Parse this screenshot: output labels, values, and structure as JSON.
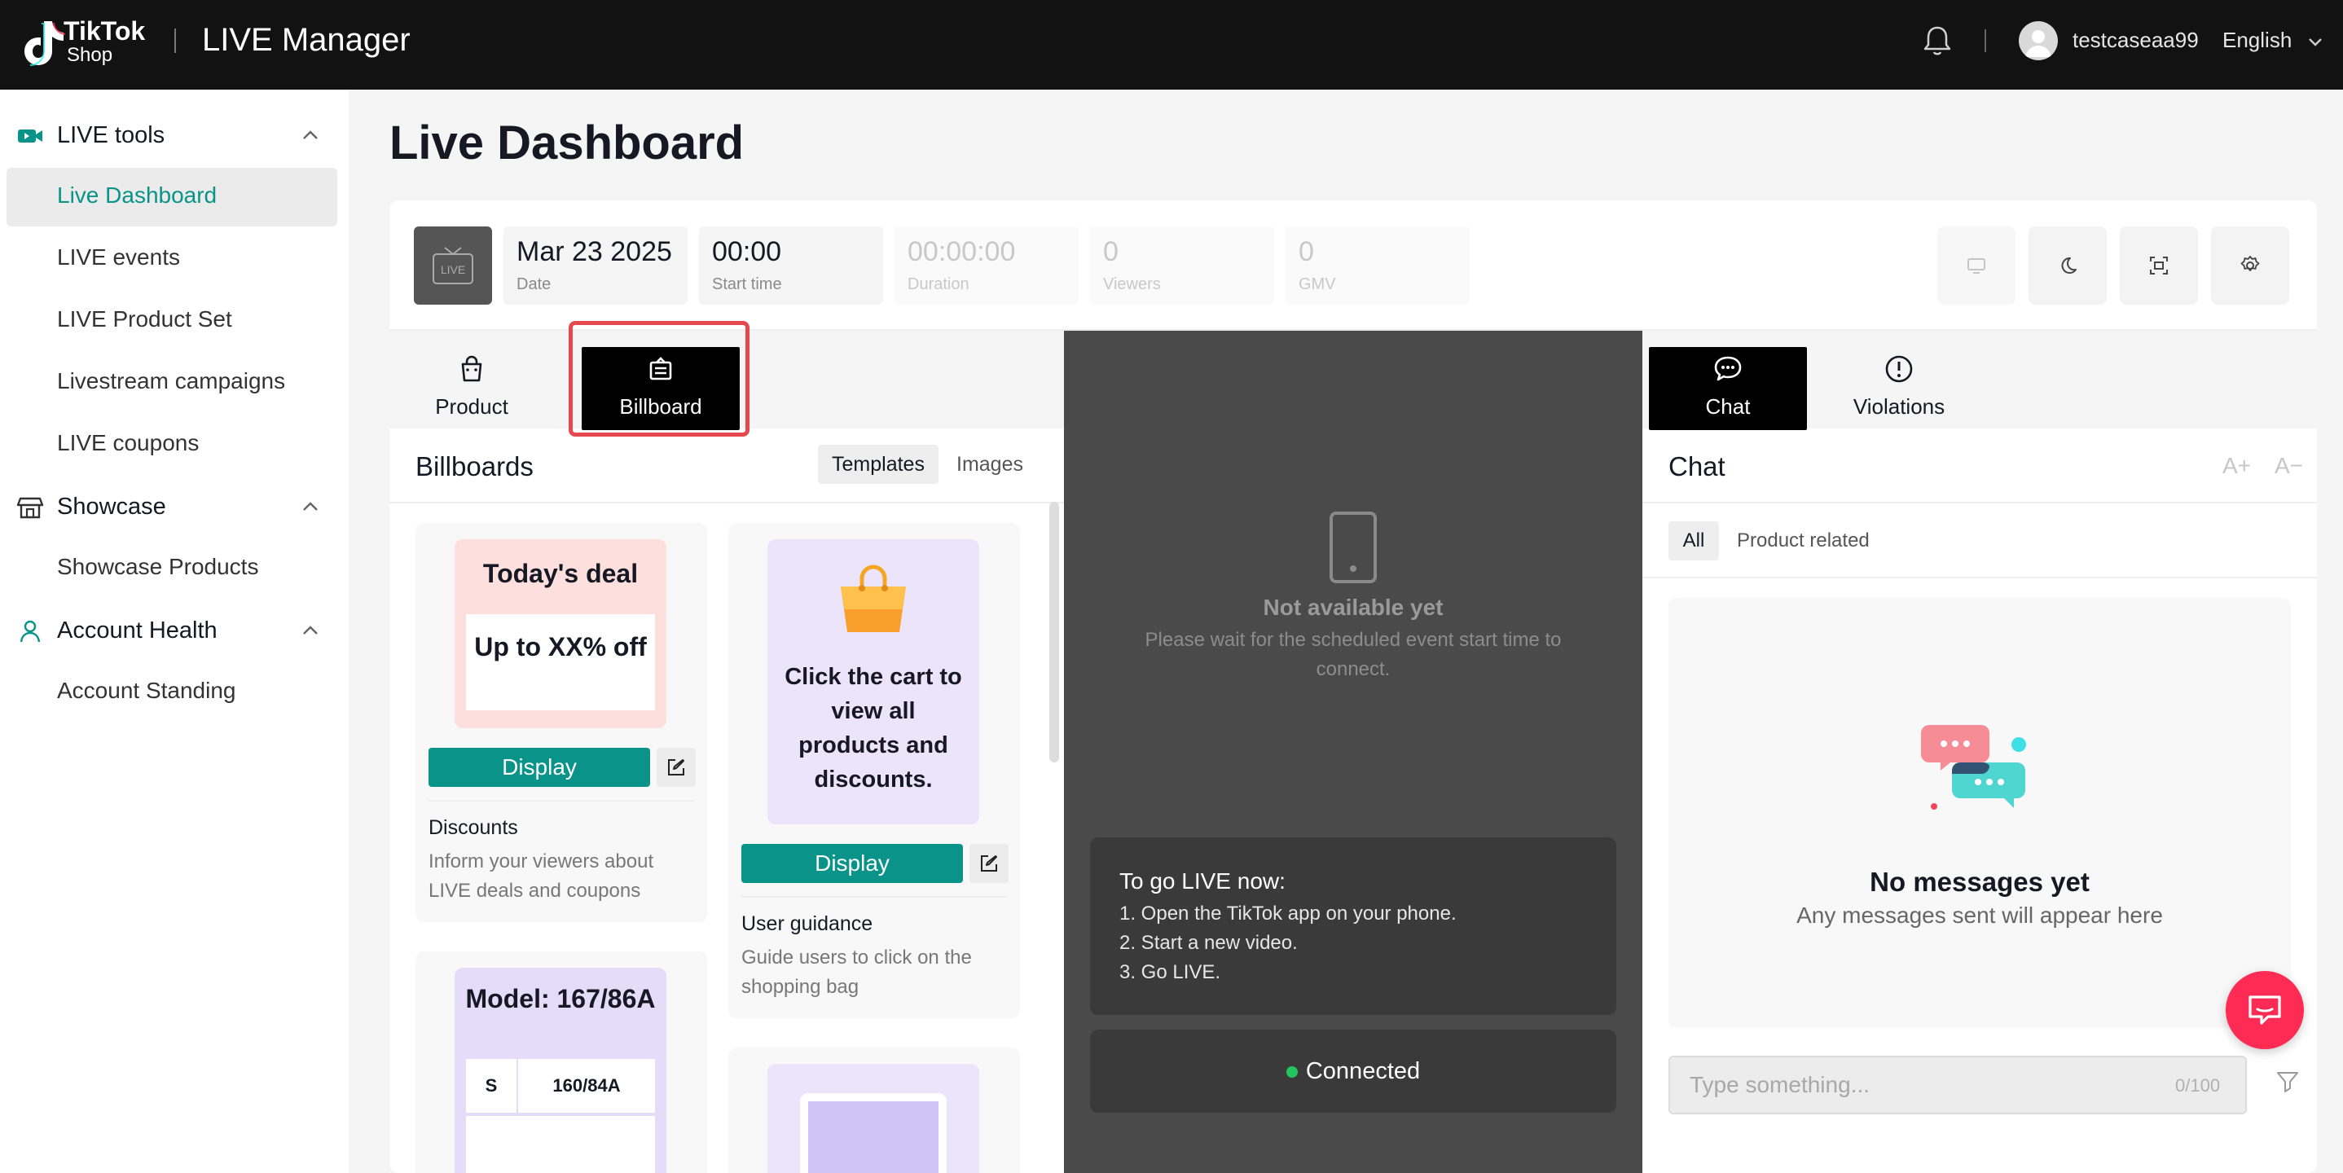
{
  "topbar": {
    "brand_tiktok": "TikTok",
    "brand_shop": "Shop",
    "app_title": "LIVE Manager",
    "username": "testcaseaa99",
    "language": "English"
  },
  "sidebar": {
    "groups": [
      {
        "label": "LIVE tools",
        "items": [
          "Live Dashboard",
          "LIVE events",
          "LIVE Product Set",
          "Livestream campaigns",
          "LIVE coupons"
        ]
      },
      {
        "label": "Showcase",
        "items": [
          "Showcase Products"
        ]
      },
      {
        "label": "Account Health",
        "items": [
          "Account Standing"
        ]
      }
    ],
    "active_item": "Live Dashboard"
  },
  "page": {
    "title": "Live Dashboard"
  },
  "stats": {
    "live_badge": "LIVE",
    "date": {
      "value": "Mar 23 2025",
      "label": "Date"
    },
    "start_time": {
      "value": "00:00",
      "label": "Start time"
    },
    "duration": {
      "value": "00:00:00",
      "label": "Duration"
    },
    "viewers": {
      "value": "0",
      "label": "Viewers"
    },
    "gmv": {
      "value": "0",
      "label": "GMV"
    }
  },
  "left_panel": {
    "tabs": [
      "Product",
      "Billboard"
    ],
    "active_tab": "Billboard",
    "section_title": "Billboards",
    "segments": [
      "Templates",
      "Images"
    ],
    "templates": [
      {
        "preview_title": "Today's deal",
        "preview_body": "Up to XX% off",
        "button": "Display",
        "name": "Discounts",
        "desc": "Inform your viewers about LIVE deals and coupons"
      },
      {
        "preview_body": "Click the cart to view all products and discounts.",
        "button": "Display",
        "name": "User guidance",
        "desc": "Guide users to click on the shopping bag"
      },
      {
        "preview_title": "Model: 167/86A",
        "size_label": "S",
        "size_value": "160/84A"
      }
    ]
  },
  "center_panel": {
    "not_available_title": "Not available yet",
    "not_available_sub": "Please wait for the scheduled event start time to connect.",
    "golive_title": "To go LIVE now:",
    "golive_steps": [
      "1. Open the TikTok app on your phone.",
      "2. Start a new video.",
      "3. Go LIVE."
    ],
    "status": "Connected"
  },
  "right_panel": {
    "tabs": [
      "Chat",
      "Violations"
    ],
    "active_tab": "Chat",
    "section_title": "Chat",
    "font_increase": "A+",
    "font_decrease": "A−",
    "filters": [
      "All",
      "Product related"
    ],
    "empty_title": "No messages yet",
    "empty_sub": "Any messages sent will appear here",
    "input_placeholder": "Type something...",
    "char_count": "0/100"
  },
  "colors": {
    "accent": "#0a9389",
    "highlight": "#e5484d",
    "fab": "#fe2c55"
  }
}
